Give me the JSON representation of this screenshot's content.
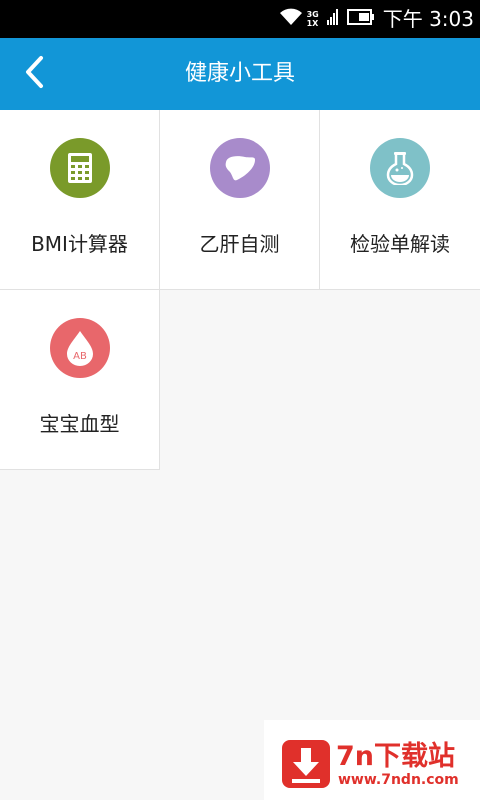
{
  "status_bar": {
    "network_top": "3G",
    "network_bottom": "1X",
    "time": "下午 3:03"
  },
  "header": {
    "title": "健康小工具"
  },
  "tools": [
    {
      "label": "BMI计算器",
      "icon": "calculator-icon",
      "color": "#7a9a2a"
    },
    {
      "label": "乙肝自测",
      "icon": "liver-icon",
      "color": "#a88bcb"
    },
    {
      "label": "检验单解读",
      "icon": "flask-icon",
      "color": "#7fc1c8"
    },
    {
      "label": "宝宝血型",
      "icon": "blood-drop-icon",
      "color": "#e8676b",
      "icon_text": "AB"
    }
  ],
  "watermark": {
    "title": "7n下载站",
    "url": "www.7ndn.com"
  },
  "colors": {
    "header_bg": "#1296d7",
    "status_bg": "#000000",
    "page_bg": "#f7f7f7",
    "watermark": "#e0302b"
  }
}
